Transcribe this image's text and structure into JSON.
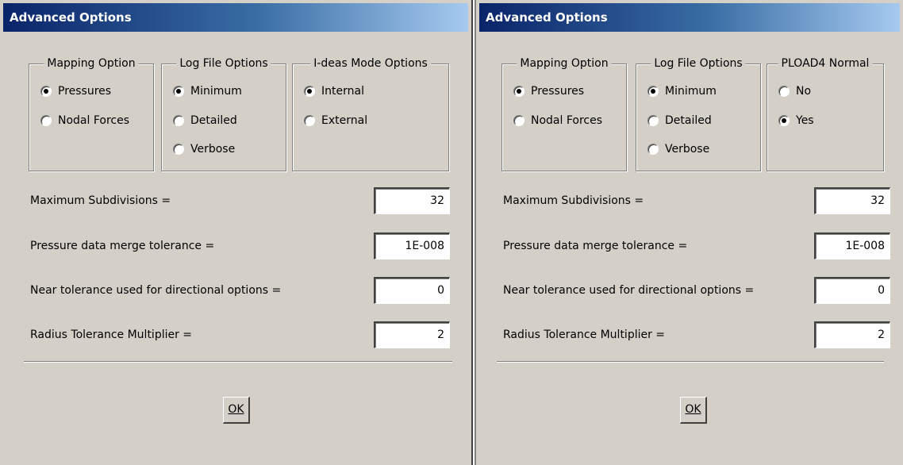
{
  "left": {
    "title": "Advanced Options",
    "groups": {
      "mapping": {
        "title": "Mapping Option",
        "options": [
          "Pressures",
          "Nodal Forces"
        ]
      },
      "log": {
        "title": "Log File Options",
        "options": [
          "Minimum",
          "Detailed",
          "Verbose"
        ]
      },
      "ideas": {
        "title": "I-deas Mode Options",
        "options": [
          "Internal",
          "External"
        ]
      }
    },
    "fields": [
      {
        "label": "Maximum Subdivisions =",
        "value": "32"
      },
      {
        "label": "Pressure data merge tolerance =",
        "value": "1E-008"
      },
      {
        "label": "Near tolerance used for directional options =",
        "value": "0"
      },
      {
        "label": "Radius Tolerance Multiplier =",
        "value": "2"
      }
    ],
    "ok_label": "OK"
  },
  "right": {
    "title": "Advanced Options",
    "groups": {
      "mapping": {
        "title": "Mapping Option",
        "options": [
          "Pressures",
          "Nodal Forces"
        ]
      },
      "log": {
        "title": "Log File Options",
        "options": [
          "Minimum",
          "Detailed",
          "Verbose"
        ]
      },
      "pload": {
        "title": "PLOAD4 Normal",
        "options": [
          "No",
          "Yes"
        ]
      }
    },
    "fields": [
      {
        "label": "Maximum Subdivisions =",
        "value": "32"
      },
      {
        "label": "Pressure data merge tolerance =",
        "value": "1E-008"
      },
      {
        "label": "Near tolerance used for directional options =",
        "value": "0"
      },
      {
        "label": "Radius Tolerance Multiplier =",
        "value": "2"
      }
    ],
    "ok_label": "OK"
  },
  "selected": {
    "left": {
      "mapping": "Pressures",
      "log": "Minimum",
      "ideas": "Internal"
    },
    "right": {
      "mapping": "Pressures",
      "log": "Minimum",
      "pload": "Yes"
    }
  },
  "colors": {
    "title_start": "#0a246a",
    "title_end": "#a6caf0",
    "face": "#d4d0c8"
  }
}
